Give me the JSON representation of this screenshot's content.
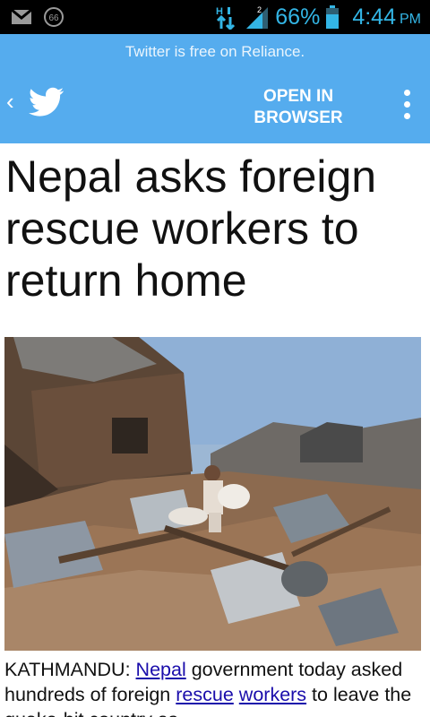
{
  "status_bar": {
    "update_badge": "66",
    "network_type": "H",
    "sim_number": "2",
    "battery_percent": "66%",
    "time": "4:44",
    "ampm": "PM",
    "icon_color": "#33b5e5"
  },
  "twitter_bar": {
    "notice": "Twitter is free on Reliance.",
    "back_glyph": "‹",
    "open_line1": "OPEN IN",
    "open_line2": "BROWSER",
    "background": "#55acee"
  },
  "article": {
    "headline": "Nepal asks foreign rescue workers to return home",
    "body": {
      "dateline": "KATHMANDU:",
      "link_nepal": "Nepal",
      "text1": "government today asked hundreds of foreign",
      "link_rescue": "rescue",
      "link_workers": "workers",
      "text2": "to leave the quake-hit country as"
    }
  }
}
